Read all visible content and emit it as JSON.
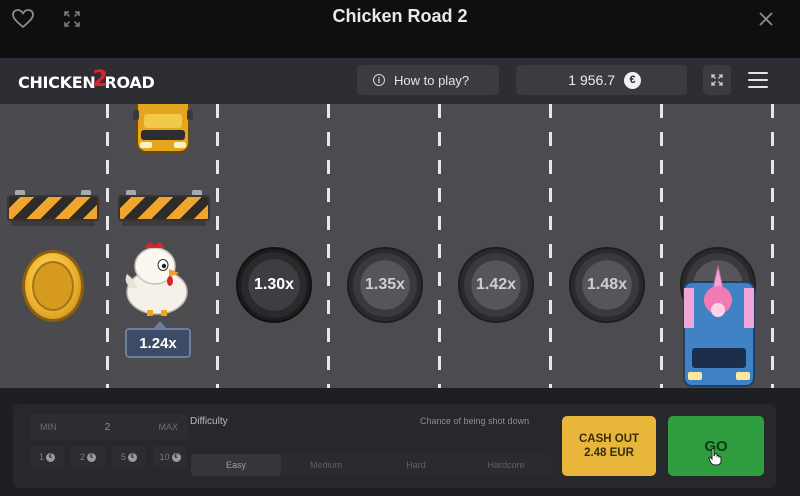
{
  "window": {
    "title": "Chicken Road 2",
    "icons": {
      "favorite": "heart-icon",
      "expand": "expand-icon",
      "close": "close-icon"
    }
  },
  "header": {
    "logo_left": "CHICKEN",
    "logo_num": "2",
    "logo_right": "ROAD",
    "how_to_play": "How to play?",
    "balance": "1 956.7",
    "currency_symbol": "€",
    "icons": {
      "info": "info-icon",
      "fullscreen": "fullscreen-icon",
      "menu": "hamburger-menu-icon"
    }
  },
  "road": {
    "current_multiplier": "1.24x",
    "multipliers": [
      "1.30x",
      "1.35x",
      "1.42x",
      "1.48x"
    ],
    "objects": [
      "gold-coin",
      "chicken",
      "barrier",
      "barrier",
      "yellow-car",
      "ice-cream-truck"
    ]
  },
  "controls": {
    "min_label": "MIN",
    "max_label": "MAX",
    "bet_value": "2",
    "quick_bets": [
      "1",
      "2",
      "5",
      "10"
    ],
    "difficulty_label": "Difficulty",
    "chance_label": "Chance of being shot down",
    "difficulties": [
      "Easy",
      "Medium",
      "Hard",
      "Hardcore"
    ],
    "selected_difficulty": "Easy",
    "cashout_label": "CASH OUT",
    "cashout_amount": "2.48 EUR",
    "go_label": "GO"
  },
  "colors": {
    "road": "#4c4c50",
    "cashout": "#e8b63b",
    "go": "#2f9e3f",
    "badge": "#3e4b66",
    "barrier_stripe": "#f0a62d"
  }
}
